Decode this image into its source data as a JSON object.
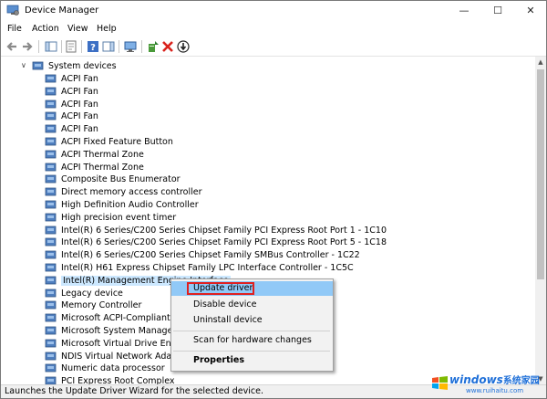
{
  "window": {
    "title": "Device Manager",
    "controls": {
      "minimize": "—",
      "maximize": "☐",
      "close": "✕"
    }
  },
  "menubar": {
    "items": [
      "File",
      "Action",
      "View",
      "Help"
    ]
  },
  "toolbar": {
    "icons": [
      "back-arrow-icon",
      "forward-arrow-icon",
      "show-hide-console-tree-icon",
      "properties-icon",
      "help-icon",
      "action-pane-icon",
      "monitor-icon",
      "update-driver-icon",
      "uninstall-icon",
      "scan-hardware-icon"
    ]
  },
  "tree": {
    "category": {
      "label": "System devices",
      "expanded": true
    },
    "items": [
      "ACPI Fan",
      "ACPI Fan",
      "ACPI Fan",
      "ACPI Fan",
      "ACPI Fan",
      "ACPI Fixed Feature Button",
      "ACPI Thermal Zone",
      "ACPI Thermal Zone",
      "Composite Bus Enumerator",
      "Direct memory access controller",
      "High Definition Audio Controller",
      "High precision event timer",
      "Intel(R) 6 Series/C200 Series Chipset Family PCI Express Root Port 1 - 1C10",
      "Intel(R) 6 Series/C200 Series Chipset Family PCI Express Root Port 5 - 1C18",
      "Intel(R) 6 Series/C200 Series Chipset Family SMBus Controller - 1C22",
      "Intel(R) H61 Express Chipset Family LPC Interface Controller - 1C5C",
      "Intel(R) Management Engine Interface",
      "Legacy device",
      "Memory Controller",
      "Microsoft ACPI-Compliant Sy",
      "Microsoft System Manageme",
      "Microsoft Virtual Drive Enume",
      "NDIS Virtual Network Adapter",
      "Numeric data processor",
      "PCI Express Root Complex"
    ],
    "selected_index": 16
  },
  "context_menu": {
    "items": [
      {
        "label": "Update driver",
        "highlighted": true,
        "bold": false
      },
      {
        "label": "Disable device",
        "highlighted": false,
        "bold": false
      },
      {
        "label": "Uninstall device",
        "highlighted": false,
        "bold": false
      },
      {
        "label": "Scan for hardware changes",
        "highlighted": false,
        "bold": false
      },
      {
        "label": "Properties",
        "highlighted": false,
        "bold": true
      }
    ]
  },
  "statusbar": {
    "text": "Launches the Update Driver Wizard for the selected device."
  },
  "watermark": {
    "brand": "windows",
    "brand_cn": "系统家园",
    "url": "www.ruihaitu.com"
  },
  "colors": {
    "selection": "#cce8ff",
    "menu_highlight": "#91c9f7",
    "callout_red": "#e02020",
    "watermark_blue": "#1e6fd8"
  }
}
